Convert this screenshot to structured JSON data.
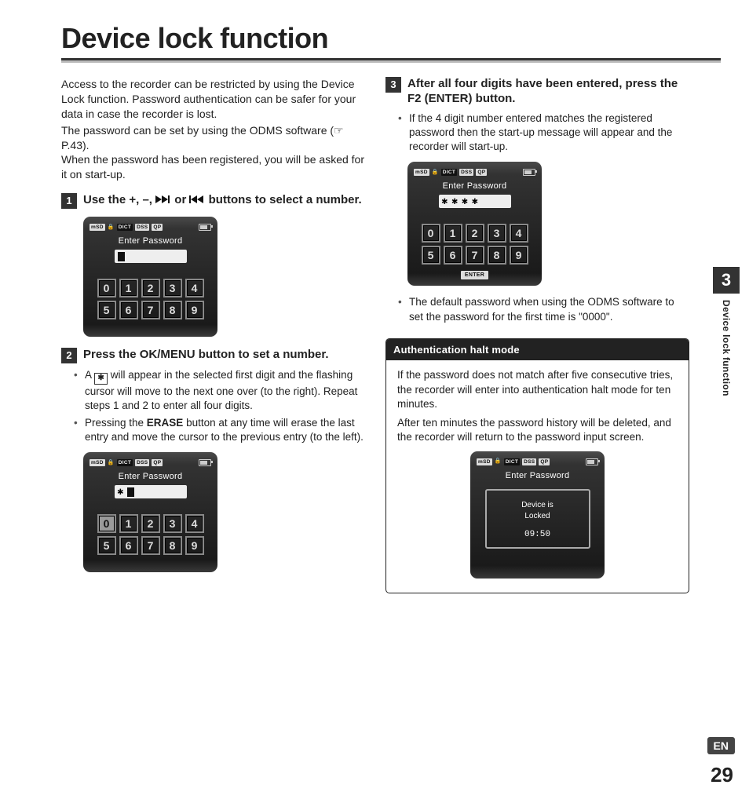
{
  "title": "Device lock function",
  "intro": [
    "Access to the recorder can be restricted by using the Device Lock function. Password authentication can be safer for your data in case the recorder is lost.",
    "The password can be set by using the ODMS software (☞ P.43).",
    "When the password has been registered, you will be asked for it on start-up."
  ],
  "steps": {
    "s1_num": "1",
    "s1_pre": "Use the +, –, ",
    "s1_mid": " or ",
    "s1_post": " buttons to select a number.",
    "s2_num": "2",
    "s2_title_a": "Press the ",
    "s2_title_b": "OK/MENU",
    "s2_title_c": " button to set a number.",
    "s2_bul1_a": "A ",
    "s2_bul1_b": " will appear in the selected first digit and the flashing cursor will move to the next one over (to the right). Repeat steps 1 and 2 to enter all four digits.",
    "s2_bul2_a": "Pressing the ",
    "s2_bul2_b": "ERASE",
    "s2_bul2_c": " button at any time will erase the last entry and move the cursor to the previous entry (to the left).",
    "s3_num": "3",
    "s3_title": "After all four digits have been entered, press the F2 (ENTER) button.",
    "s3_bul1": "If the 4 digit number entered matches the registered password then the start-up message will appear and the recorder will start-up.",
    "s3_bul2": "The default password when using the ODMS software to set the password for the first time is \"0000\"."
  },
  "device": {
    "label": "Enter Password",
    "keys": [
      "0",
      "1",
      "2",
      "3",
      "4",
      "5",
      "6",
      "7",
      "8",
      "9"
    ],
    "enter": "ENTER",
    "status": {
      "sd": "mSD",
      "dict": "DICT",
      "dss": "DSS",
      "qp": "QP"
    },
    "lock_line1": "Device is",
    "lock_line2": "Locked",
    "lock_time": "09:50",
    "star": "✱"
  },
  "note": {
    "head": "Authentication halt mode",
    "p1": "If the password does not match after five consecutive tries, the recorder will enter into authentication halt mode for ten minutes.",
    "p2": "After ten minutes the password history will be deleted, and the recorder will return to the password input screen."
  },
  "side": {
    "num": "3",
    "label": "Device lock function"
  },
  "footer": {
    "lang": "EN",
    "page": "29"
  }
}
